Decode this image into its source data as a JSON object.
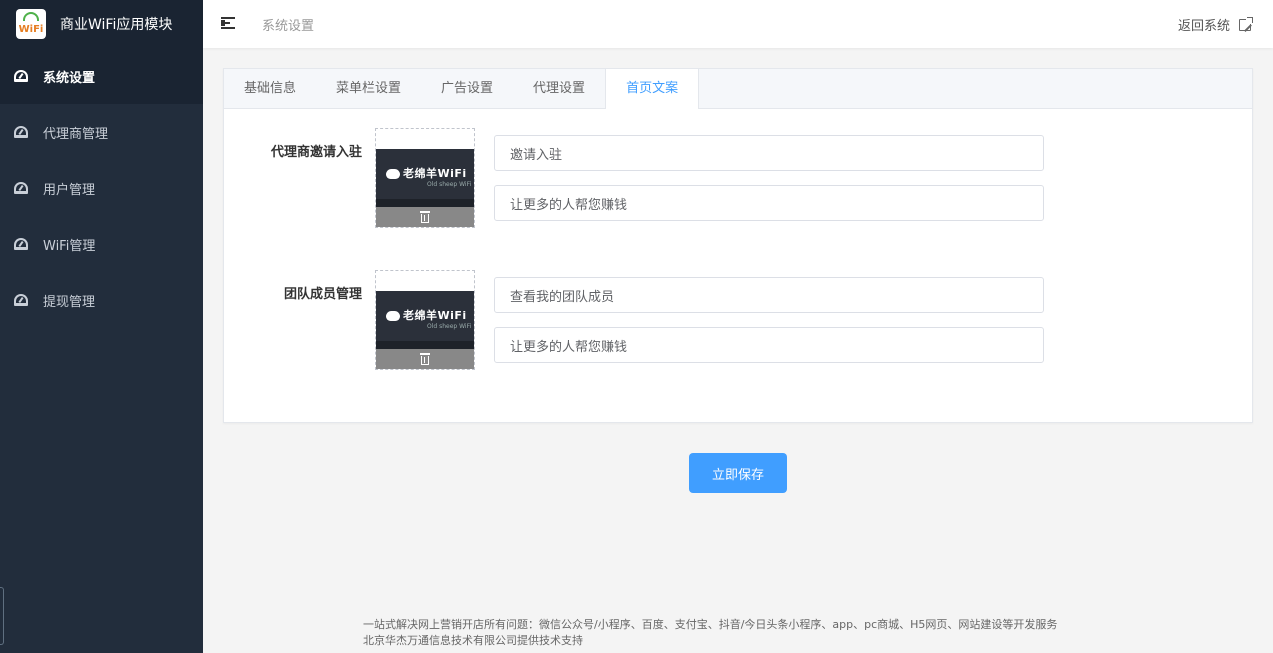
{
  "brand": {
    "title": "商业WiFi应用模块",
    "logo_text": "WiFi"
  },
  "sidebar": {
    "items": [
      {
        "label": "系统设置",
        "icon": "dashboard-icon",
        "active": true
      },
      {
        "label": "代理商管理",
        "icon": "dashboard-icon",
        "active": false
      },
      {
        "label": "用户管理",
        "icon": "dashboard-icon",
        "active": false
      },
      {
        "label": "WiFi管理",
        "icon": "dashboard-icon",
        "active": false
      },
      {
        "label": "提现管理",
        "icon": "dashboard-icon",
        "active": false
      }
    ]
  },
  "header": {
    "breadcrumb": "系统设置",
    "return_label": "返回系统",
    "return_icon": "external-link-icon",
    "menu_icon": "menu-fold-icon"
  },
  "tabs": [
    {
      "label": "基础信息",
      "active": false
    },
    {
      "label": "菜单栏设置",
      "active": false
    },
    {
      "label": "广告设置",
      "active": false
    },
    {
      "label": "代理设置",
      "active": false
    },
    {
      "label": "首页文案",
      "active": true
    }
  ],
  "form": {
    "rows": [
      {
        "label": "代理商邀请入驻",
        "image_text": "老绵羊WiFi",
        "image_sub": "Old sheep WiFi",
        "title_value": "邀请入驻",
        "desc_value": "让更多的人帮您赚钱"
      },
      {
        "label": "团队成员管理",
        "image_text": "老绵羊WiFi",
        "image_sub": "Old sheep WiFi",
        "title_value": "查看我的团队成员",
        "desc_value": "让更多的人帮您赚钱"
      }
    ]
  },
  "actions": {
    "save_label": "立即保存"
  },
  "footer": {
    "line1": "一站式解决网上营销开店所有问题：微信公众号/小程序、百度、支付宝、抖音/今日头条小程序、app、pc商城、H5网页、网站建设等开发服务",
    "line2": "北京华杰万通信息技术有限公司提供技术支持"
  },
  "colors": {
    "sidebar_bg": "#222d3c",
    "sidebar_active_bg": "#1a2432",
    "accent": "#409eff"
  }
}
